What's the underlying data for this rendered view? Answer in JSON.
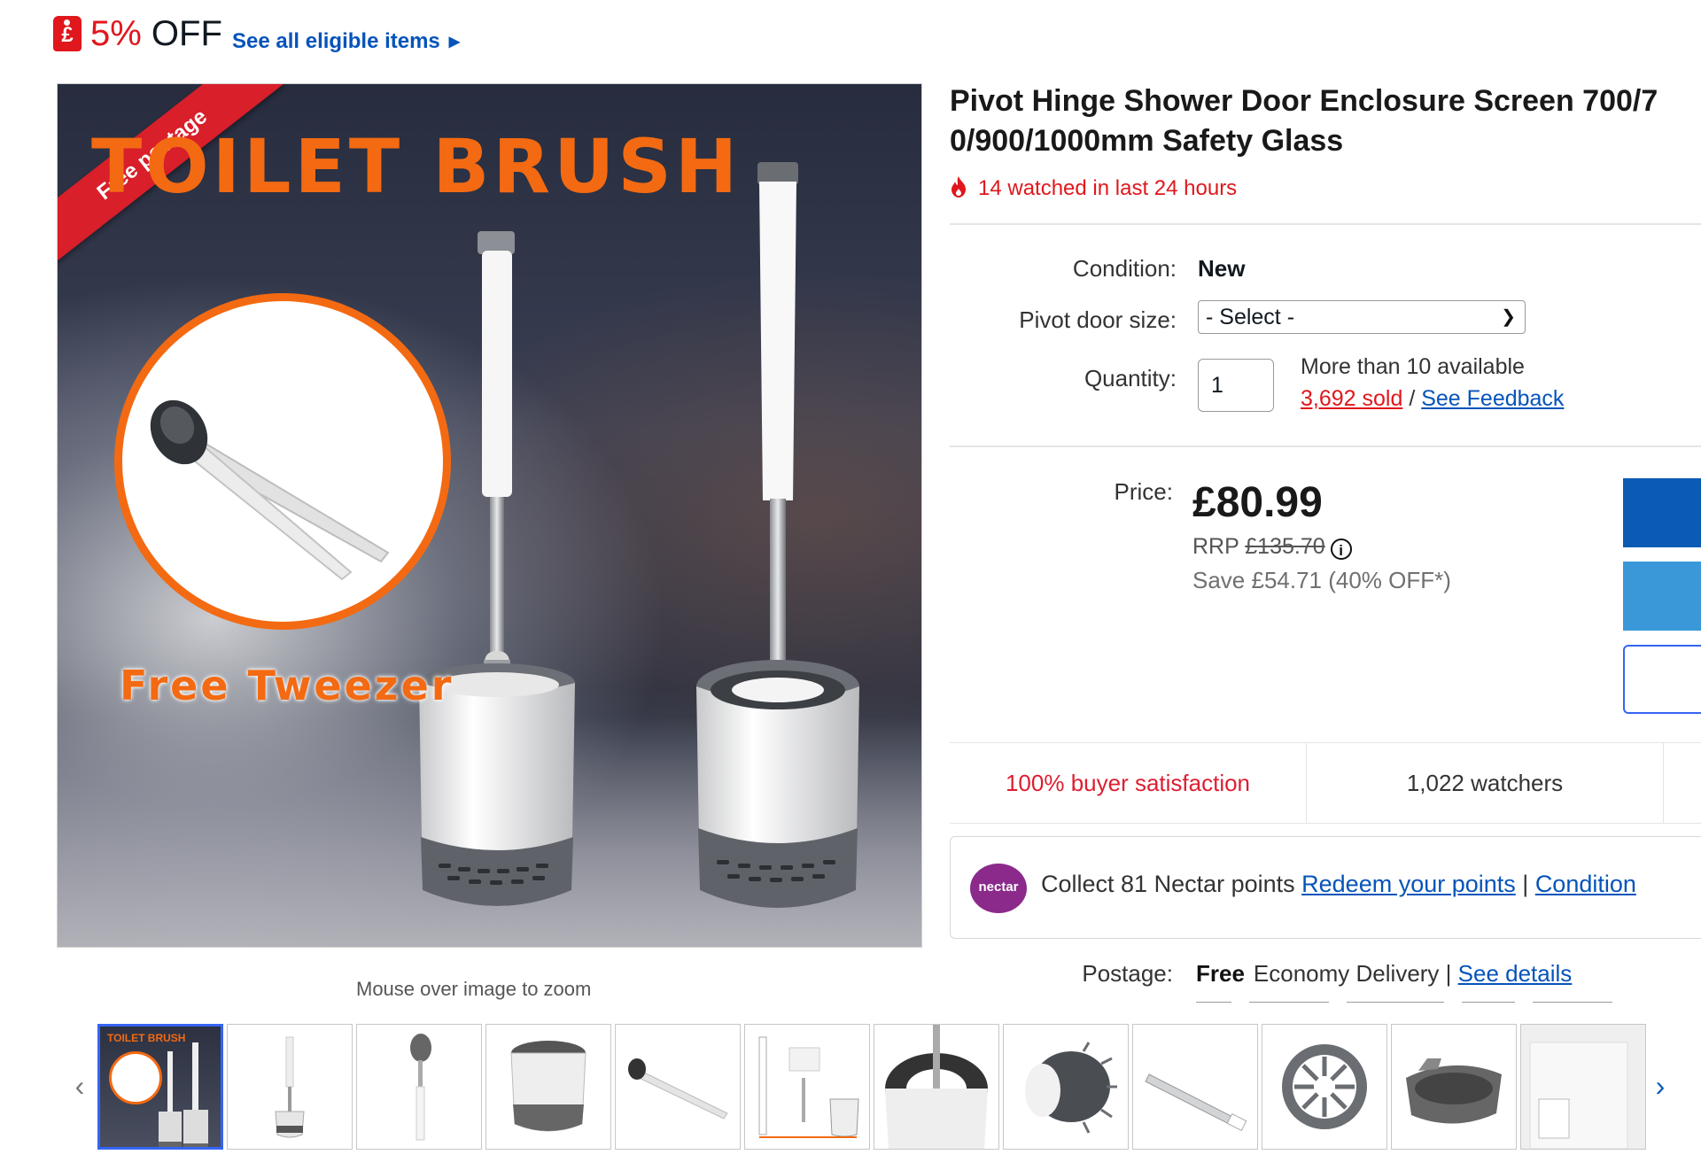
{
  "promo": {
    "tag_symbol": "£",
    "discount": "5%",
    "off": " OFF",
    "link": "See all eligible items"
  },
  "image": {
    "ribbon": "Free postage",
    "headline": "TOILET BRUSH",
    "tweezer_caption": "Free Tweezer",
    "zoom_hint": "Mouse over image to zoom",
    "thumbnail_headline": "TOILET BRUSH"
  },
  "product": {
    "title_line1": "Pivot Hinge Shower Door Enclosure Screen 700/7",
    "title_line2": "0/900/1000mm Safety Glass",
    "watched": "14 watched in last 24 hours"
  },
  "options": {
    "condition_label": "Condition:",
    "condition_value": "New",
    "size_label": "Pivot door size:",
    "size_selected": "- Select -",
    "quantity_label": "Quantity:",
    "quantity_value": "1",
    "availability": "More than 10 available",
    "sold": "3,692 sold",
    "sold_separator": " / ",
    "feedback": "See Feedback"
  },
  "pricing": {
    "price_label": "Price:",
    "price": "£80.99",
    "rrp_label": "RRP ",
    "rrp_value": "£135.70",
    "info_icon_glyph": "i",
    "save": "Save £54.71 (40% OFF*)"
  },
  "stats": {
    "satisfaction": "100% buyer satisfaction",
    "watchers": "1,022 watchers"
  },
  "nectar": {
    "logo": "nectar",
    "text": "Collect 81 Nectar points ",
    "redeem": "Redeem your points",
    "separator": " | ",
    "conditions": "Condition"
  },
  "postage": {
    "label": "Postage:",
    "free": "Free",
    "method": "Economy Delivery",
    "separator": " | ",
    "details": "See details"
  },
  "thumbnails": {
    "prev": "‹",
    "next": "›",
    "count": 12,
    "selected_index": 0
  },
  "colors": {
    "accent_red": "#e0171c",
    "link_blue": "#0654ba",
    "brand_orange": "#f36a12",
    "primary_button": "#0b5bb5",
    "secondary_button": "#3a98d8"
  }
}
